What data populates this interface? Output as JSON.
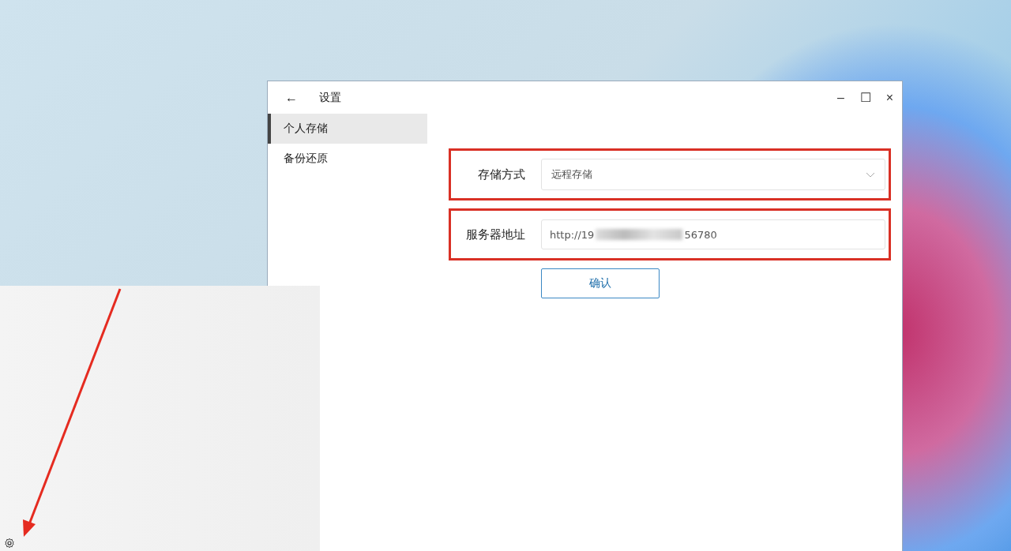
{
  "window": {
    "back": "←",
    "title": "设置",
    "controls": [
      "–",
      "☐",
      "×"
    ]
  },
  "sidebar": {
    "items": [
      {
        "label": "个人存储",
        "selected": true
      },
      {
        "label": "备份还原",
        "selected": false
      }
    ]
  },
  "form": {
    "fields": [
      {
        "kind": "select",
        "label": "存储方式",
        "value": "远程存储",
        "highlighted": true
      },
      {
        "kind": "input",
        "label": "服务器地址",
        "value_start": "http://19",
        "redacted": true,
        "value_end": "56780",
        "highlighted": true
      }
    ],
    "confirm": "确认"
  }
}
